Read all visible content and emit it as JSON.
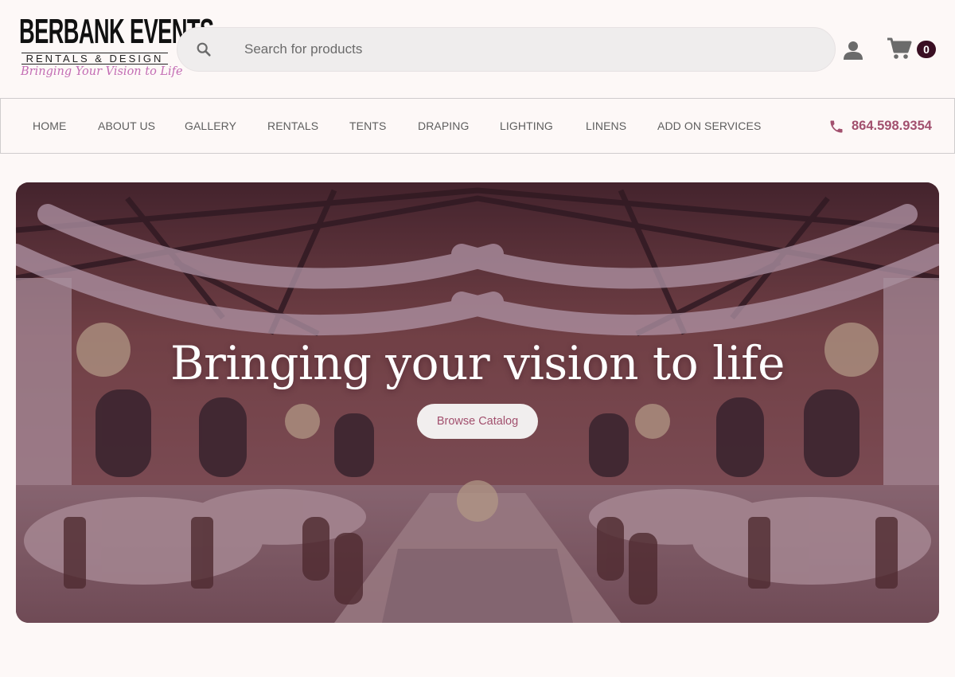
{
  "brand": {
    "name": "BERBANK EVENTS",
    "sub": "RENTALS & DESIGN",
    "tagline": "Bringing Your Vision to Life"
  },
  "search": {
    "placeholder": "Search for products",
    "value": ""
  },
  "header": {
    "user_icon": "user-icon",
    "cart_icon": "cart-icon",
    "cart_count": "0"
  },
  "nav": {
    "items": [
      {
        "label": "HOME"
      },
      {
        "label": "ABOUT US"
      },
      {
        "label": "GALLERY"
      },
      {
        "label": "RENTALS"
      },
      {
        "label": "TENTS"
      },
      {
        "label": "DRAPING"
      },
      {
        "label": "LIGHTING"
      },
      {
        "label": "LINENS"
      },
      {
        "label": "ADD ON SERVICES"
      }
    ],
    "phone": "864.598.9354"
  },
  "hero": {
    "title": "Bringing your vision to life",
    "button": "Browse Catalog"
  },
  "colors": {
    "accent": "#a2506e",
    "badge": "#3a0f23",
    "background": "#fdf8f7",
    "overlay": "#6a3a50"
  }
}
